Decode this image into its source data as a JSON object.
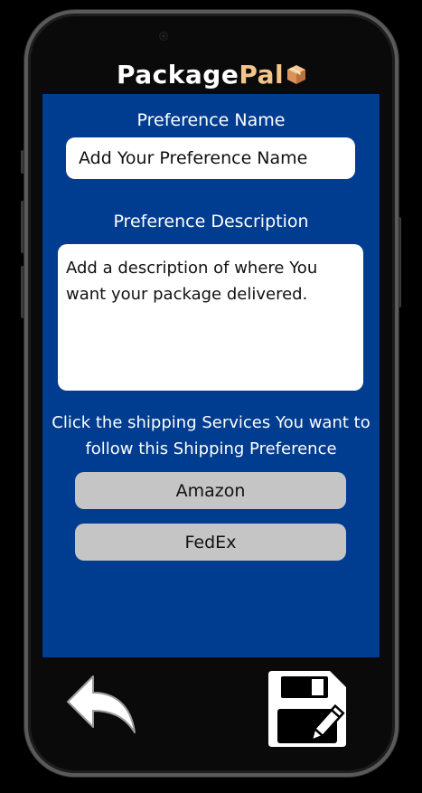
{
  "app": {
    "title_part1": "Package",
    "title_part2": "Pal",
    "logo_icon": "package-box-icon"
  },
  "form": {
    "name_label": "Preference Name",
    "name_placeholder": "Add Your Preference Name",
    "description_label": "Preference Description",
    "description_placeholder": "Add a description of where You want your package delivered.",
    "instructions": "Click the shipping Services You want to follow this Shipping Preference"
  },
  "services": [
    {
      "label": "Amazon"
    },
    {
      "label": "FedEx"
    }
  ],
  "nav": {
    "back_icon": "back-arrow-icon",
    "save_icon": "floppy-save-edit-icon"
  },
  "colors": {
    "screen_background": "#003c8f",
    "logo_accent": "#f4c58a",
    "service_button": "#c5c5c5",
    "phone_background": "#000000"
  }
}
